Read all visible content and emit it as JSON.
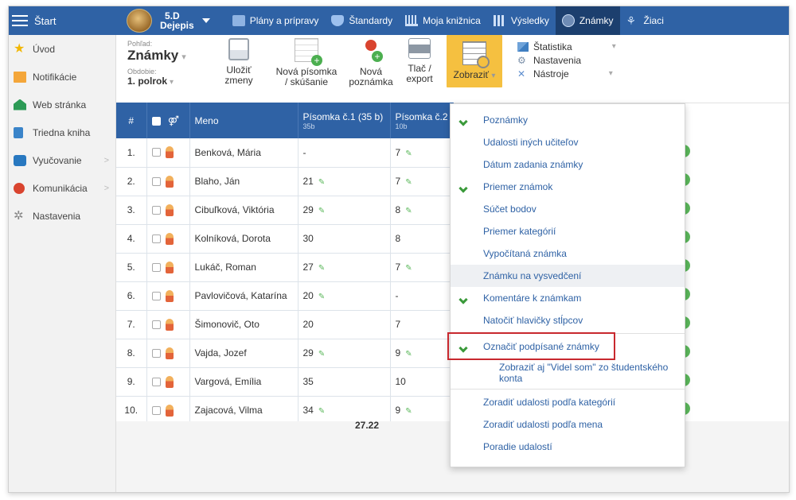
{
  "topbar": {
    "start_label": "Štart",
    "class_name": "5.D",
    "class_subject": "Dejepis",
    "nav": [
      {
        "label": "Plány a prípravy",
        "icon": "clipboard-icon",
        "active": false
      },
      {
        "label": "Štandardy",
        "icon": "shield-icon",
        "active": false
      },
      {
        "label": "Moja knižnica",
        "icon": "library-icon",
        "active": false
      },
      {
        "label": "Výsledky",
        "icon": "bar-chart-icon",
        "active": false
      },
      {
        "label": "Známky",
        "icon": "grade-icon",
        "active": true
      },
      {
        "label": "Žiaci",
        "icon": "students-icon",
        "active": false
      }
    ]
  },
  "sidebar": {
    "items": [
      {
        "label": "Úvod",
        "icon": "star-icon",
        "has_submenu": false
      },
      {
        "label": "Notifikácie",
        "icon": "mail-icon",
        "has_submenu": false
      },
      {
        "label": "Web stránka",
        "icon": "home-icon",
        "has_submenu": false
      },
      {
        "label": "Triedna kniha",
        "icon": "book-icon",
        "has_submenu": false
      },
      {
        "label": "Vyučovanie",
        "icon": "open-book-icon",
        "has_submenu": true
      },
      {
        "label": "Komunikácia",
        "icon": "chat-icon",
        "has_submenu": true
      },
      {
        "label": "Nastavenia",
        "icon": "gear-icon",
        "has_submenu": false
      }
    ]
  },
  "toolbar": {
    "view_label": "Pohľad:",
    "view_value": "Známky",
    "period_label": "Obdobie:",
    "period_value": "1. polrok",
    "save_line1": "Uložiť",
    "save_line2": "zmeny",
    "new_test_line1": "Nová písomka",
    "new_test_line2": "/ skúšanie",
    "new_note_line1": "Nová",
    "new_note_line2": "poznámka",
    "print_line1": "Tlač /",
    "print_line2": "export",
    "show_label": "Zobraziť",
    "stats_label": "Štatistika",
    "settings_label": "Nastavenia",
    "tools_label": "Nástroje"
  },
  "table": {
    "headers": {
      "num": "#",
      "name": "Meno",
      "col1_title": "Písomka č.1 (35 b)",
      "col1_sub": "35b",
      "col2_title": "Písomka č.2",
      "col2_sub": "10b"
    },
    "rows": [
      {
        "n": "1.",
        "name": "Benková, Mária",
        "g1": "-",
        "g1_signed": false,
        "g2": "7",
        "g2_signed": true
      },
      {
        "n": "2.",
        "name": "Blaho, Ján",
        "g1": "21",
        "g1_signed": true,
        "g2": "7",
        "g2_signed": true
      },
      {
        "n": "3.",
        "name": "Cibuľková, Viktória",
        "g1": "29",
        "g1_signed": true,
        "g2": "8",
        "g2_signed": true
      },
      {
        "n": "4.",
        "name": "Kolníková, Dorota",
        "g1": "30",
        "g1_signed": false,
        "g2": "8",
        "g2_signed": false
      },
      {
        "n": "5.",
        "name": "Lukáč, Roman",
        "g1": "27",
        "g1_signed": true,
        "g2": "7",
        "g2_signed": true
      },
      {
        "n": "6.",
        "name": "Pavlovičová, Katarína",
        "g1": "20",
        "g1_signed": true,
        "g2": "-",
        "g2_signed": false
      },
      {
        "n": "7.",
        "name": "Šimonovič, Oto",
        "g1": "20",
        "g1_signed": false,
        "g2": "7",
        "g2_signed": false
      },
      {
        "n": "8.",
        "name": "Vajda, Jozef",
        "g1": "29",
        "g1_signed": true,
        "g2": "9",
        "g2_signed": true
      },
      {
        "n": "9.",
        "name": "Vargová, Emília",
        "g1": "35",
        "g1_signed": false,
        "g2": "10",
        "g2_signed": false
      },
      {
        "n": "10.",
        "name": "Zajacová, Vilma",
        "g1": "34",
        "g1_signed": true,
        "g2": "9",
        "g2_signed": true
      }
    ],
    "average": "27.22"
  },
  "dropdown": {
    "items": [
      {
        "label": "Poznámky",
        "checked": true
      },
      {
        "label": "Udalosti iných učiteľov",
        "checked": false
      },
      {
        "label": "Dátum zadania známky",
        "checked": false
      },
      {
        "label": "Priemer známok",
        "checked": true
      },
      {
        "label": "Súčet bodov",
        "checked": false
      },
      {
        "label": "Priemer kategórií",
        "checked": false
      },
      {
        "label": "Vypočítaná známka",
        "checked": false
      },
      {
        "label": "Známku na vysvedčení",
        "checked": false,
        "highlighted": true
      },
      {
        "label": "Komentáre k známkam",
        "checked": true
      },
      {
        "label": "Natočiť hlavičky stĺpcov",
        "checked": false
      }
    ],
    "signed_item": {
      "label": "Označiť podpísané známky",
      "checked": true
    },
    "signed_sub_label": "Zobraziť aj \"Videl som\" zo študentského konta",
    "bottom_items": [
      "Zoradiť udalosti podľa kategórií",
      "Zoradiť udalosti podľa mena",
      "Poradie udalostí"
    ]
  },
  "colors": {
    "header_blue": "#2f62a5",
    "active_yellow": "#f5c040",
    "check_green": "#3b9a3b",
    "highlight_red": "#c8282e"
  }
}
